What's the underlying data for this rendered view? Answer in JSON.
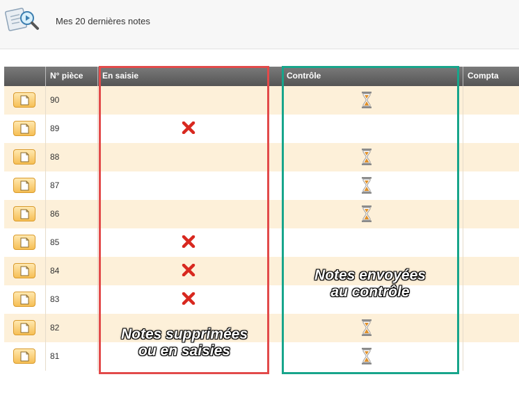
{
  "header": {
    "title": "Mes 20 dernières notes",
    "icon": "search-document-icon"
  },
  "columns": {
    "piece": "N° pièce",
    "saisie": "En saisie",
    "controle": "Contrôle",
    "compta": "Compta"
  },
  "rows": [
    {
      "piece": "90",
      "saisie": "",
      "controle": "hourglass"
    },
    {
      "piece": "89",
      "saisie": "deleted",
      "controle": ""
    },
    {
      "piece": "88",
      "saisie": "",
      "controle": "hourglass"
    },
    {
      "piece": "87",
      "saisie": "",
      "controle": "hourglass"
    },
    {
      "piece": "86",
      "saisie": "",
      "controle": "hourglass"
    },
    {
      "piece": "85",
      "saisie": "deleted",
      "controle": ""
    },
    {
      "piece": "84",
      "saisie": "deleted",
      "controle": ""
    },
    {
      "piece": "83",
      "saisie": "deleted",
      "controle": ""
    },
    {
      "piece": "82",
      "saisie": "",
      "controle": "hourglass"
    },
    {
      "piece": "81",
      "saisie": "",
      "controle": "hourglass"
    }
  ],
  "annotations": {
    "red": {
      "line1": "Notes supprimées",
      "line2": "ou en saisies",
      "color": "#e24a4a"
    },
    "green": {
      "line1": "Notes envoyées",
      "line2": "au contrôle",
      "color": "#17a58b"
    }
  },
  "colors": {
    "row_even": "#fdf0d9",
    "header_bg": "#5e5e5e",
    "delete_red": "#d8281f",
    "hourglass": "#e0912a"
  }
}
